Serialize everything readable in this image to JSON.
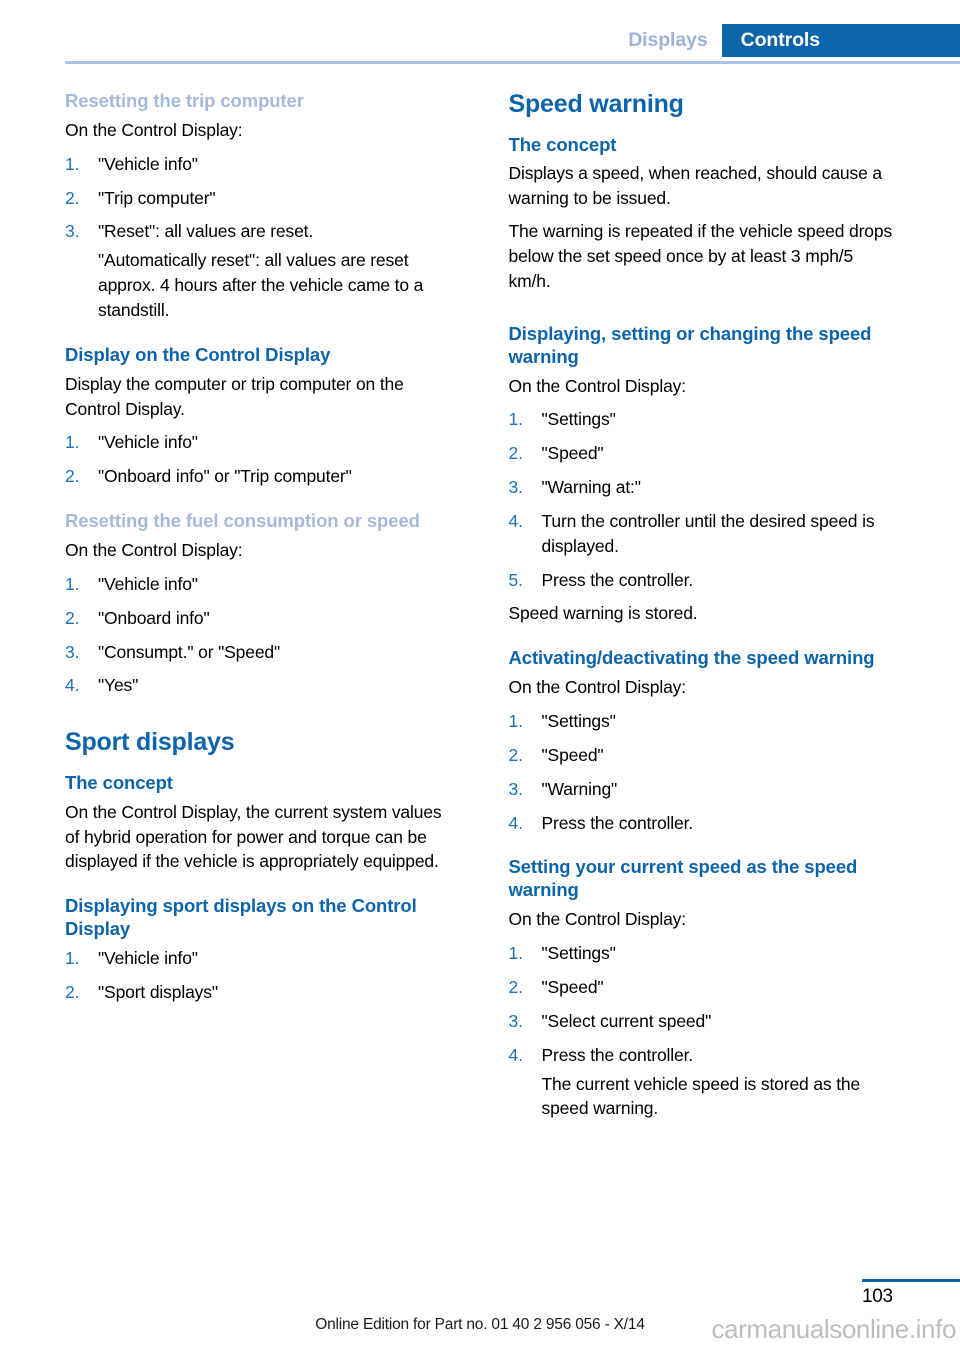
{
  "header": {
    "tab_inactive": "Displays",
    "tab_active": "Controls",
    "accent_blue": "#0d64ab",
    "faded_blue": "#a3bad9",
    "rule_color": "#a9c3e2"
  },
  "left_column": {
    "sec1": {
      "heading": "Resetting the trip computer",
      "heading_style": "faded",
      "intro": "On the Control Display:",
      "steps": [
        {
          "num": "1.",
          "text": "\"Vehicle info\""
        },
        {
          "num": "2.",
          "text": "\"Trip computer\""
        },
        {
          "num": "3.",
          "text": "\"Reset\": all values are reset.",
          "sub": "\"Automatically reset\": all values are reset approx. 4 hours after the vehicle came to a standstill."
        }
      ]
    },
    "sec2": {
      "heading": "Display on the Control Display",
      "heading_style": "strong",
      "intro": "Display the computer or trip computer on the Control Display.",
      "steps": [
        {
          "num": "1.",
          "text": "\"Vehicle info\""
        },
        {
          "num": "2.",
          "text": "\"Onboard info\" or \"Trip computer\""
        }
      ]
    },
    "sec3": {
      "heading": "Resetting the fuel consumption or speed",
      "heading_style": "faded",
      "intro": "On the Control Display:",
      "steps": [
        {
          "num": "1.",
          "text": "\"Vehicle info\""
        },
        {
          "num": "2.",
          "text": "\"Onboard info\""
        },
        {
          "num": "3.",
          "text": "\"Consumpt.\" or \"Speed\""
        },
        {
          "num": "4.",
          "text": "\"Yes\""
        }
      ]
    },
    "sec4": {
      "title": "Sport displays",
      "heading": "The concept",
      "heading_style": "strong",
      "intro": "On the Control Display, the current system values of hybrid operation for power and torque can be displayed if the vehicle is appropriately equipped."
    },
    "sec5": {
      "heading": "Displaying sport displays on the Control Display",
      "heading_style": "strong",
      "steps": [
        {
          "num": "1.",
          "text": "\"Vehicle info\""
        },
        {
          "num": "2.",
          "text": "\"Sport displays\""
        }
      ]
    }
  },
  "right_column": {
    "sec1": {
      "title": "Speed warning",
      "heading": "The concept",
      "heading_style": "strong",
      "para1": "Displays a speed, when reached, should cause a warning to be issued.",
      "para2": "The warning is repeated if the vehicle speed drops below the set speed once by at least 3 mph/5 km/h."
    },
    "sec2": {
      "heading": "Displaying, setting or changing the speed warning",
      "heading_style": "strong",
      "intro": "On the Control Display:",
      "steps": [
        {
          "num": "1.",
          "text": "\"Settings\""
        },
        {
          "num": "2.",
          "text": "\"Speed\""
        },
        {
          "num": "3.",
          "text": "\"Warning at:\""
        },
        {
          "num": "4.",
          "text": "Turn the controller until the desired speed is displayed."
        },
        {
          "num": "5.",
          "text": "Press the controller."
        }
      ],
      "after": "Speed warning is stored."
    },
    "sec3": {
      "heading": "Activating/deactivating the speed warning",
      "heading_style": "strong",
      "intro": "On the Control Display:",
      "steps": [
        {
          "num": "1.",
          "text": "\"Settings\""
        },
        {
          "num": "2.",
          "text": "\"Speed\""
        },
        {
          "num": "3.",
          "text": "\"Warning\""
        },
        {
          "num": "4.",
          "text": "Press the controller."
        }
      ]
    },
    "sec4": {
      "heading": "Setting your current speed as the speed warning",
      "heading_style": "strong",
      "intro": "On the Control Display:",
      "steps": [
        {
          "num": "1.",
          "text": "\"Settings\""
        },
        {
          "num": "2.",
          "text": "\"Speed\""
        },
        {
          "num": "3.",
          "text": "\"Select current speed\""
        },
        {
          "num": "4.",
          "text": "Press the controller.",
          "sub": "The current vehicle speed is stored as the speed warning."
        }
      ]
    }
  },
  "footer": {
    "page_number": "103",
    "note": "Online Edition for Part no. 01 40 2 956 056 - X/14",
    "watermark": "carmanualsonline.info"
  }
}
